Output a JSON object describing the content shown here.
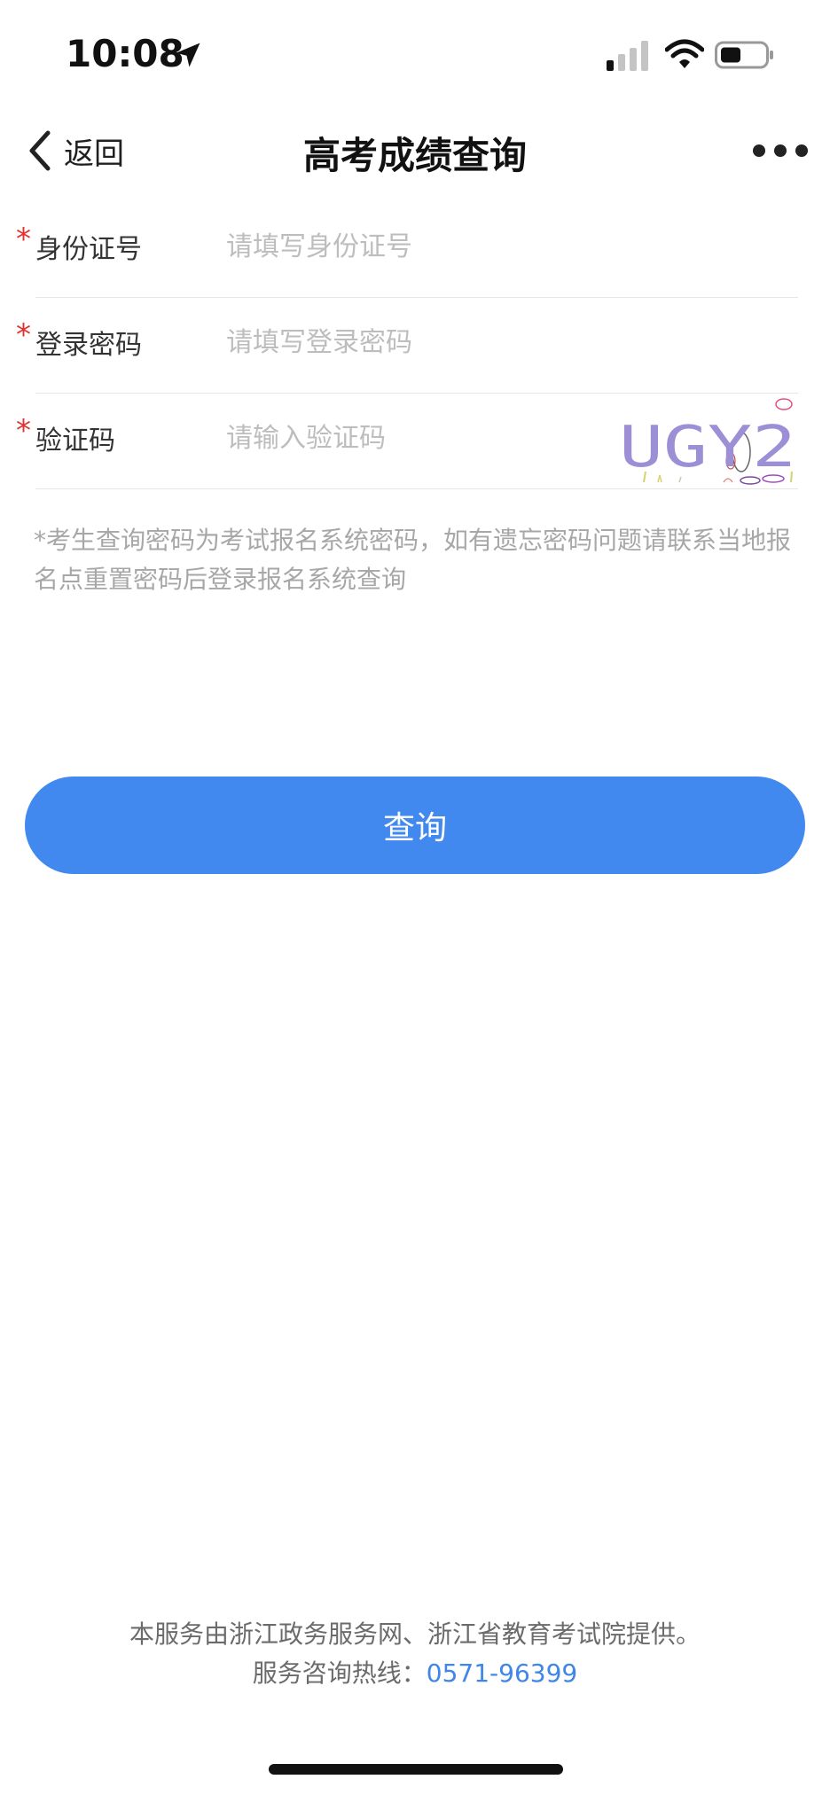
{
  "status_bar": {
    "time": "10:08",
    "location_icon": "location-arrow-icon",
    "signal_icon": "cellular-signal-icon",
    "wifi_icon": "wifi-icon",
    "battery_icon": "battery-icon"
  },
  "nav": {
    "back_label": "返回",
    "title": "高考成绩查询",
    "more_icon": "more-dots-icon"
  },
  "form": {
    "required_mark": "*",
    "fields": [
      {
        "label": "身份证号",
        "placeholder": "请填写身份证号",
        "value": ""
      },
      {
        "label": "登录密码",
        "placeholder": "请填写登录密码",
        "value": ""
      },
      {
        "label": "验证码",
        "placeholder": "请输入验证码",
        "value": ""
      }
    ],
    "captcha_text": "UGY2"
  },
  "notice": "*考生查询密码为考试报名系统密码，如有遗忘密码问题请联系当地报名点重置密码后登录报名系统查询",
  "query_button_label": "查询",
  "footer": {
    "line1": "本服务由浙江政务服务网、浙江省教育考试院提供。",
    "hotline_label": "服务咨询热线：",
    "hotline_number": "0571-96399"
  },
  "colors": {
    "accent": "#4289ef",
    "required": "#e0332f",
    "link": "#3f86e8"
  }
}
